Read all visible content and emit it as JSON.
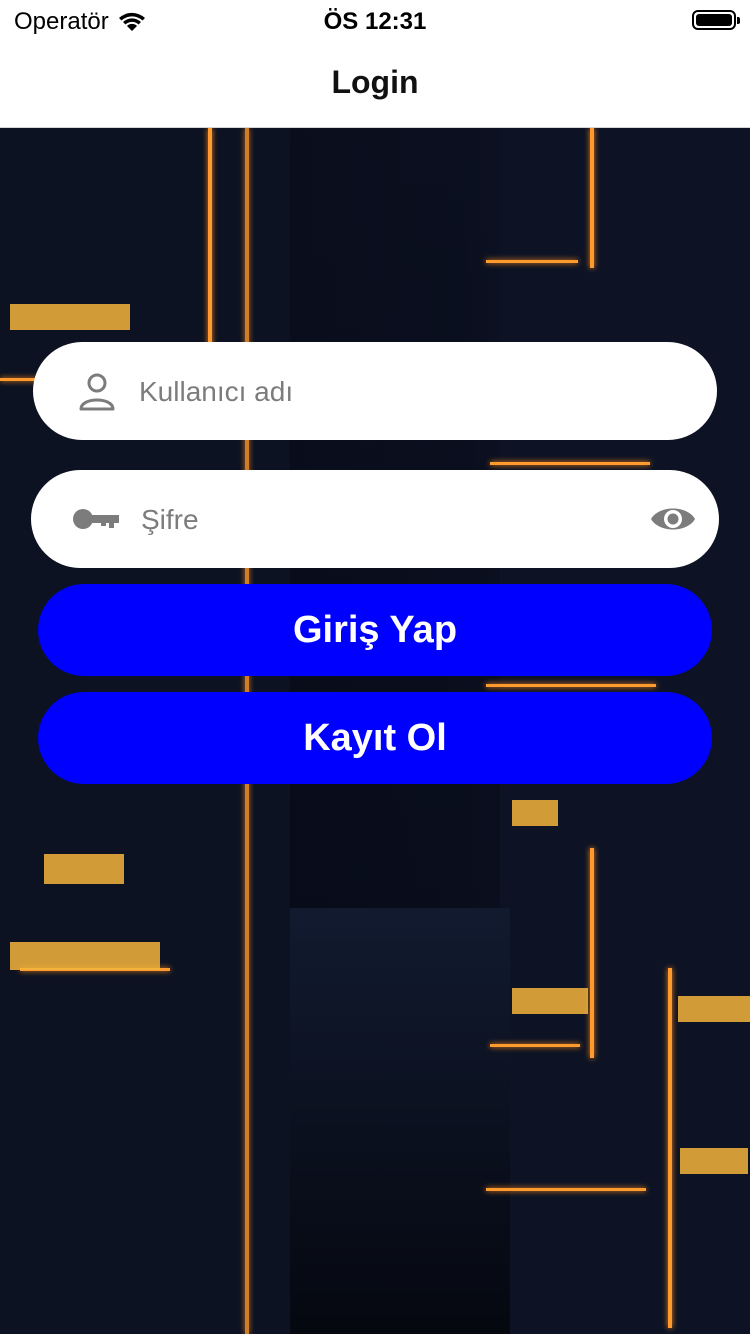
{
  "status": {
    "carrier": "Operatör",
    "time": "ÖS 12:31"
  },
  "nav": {
    "title": "Login"
  },
  "form": {
    "username_placeholder": "Kullanıcı adı",
    "password_placeholder": "Şifre",
    "login_label": "Giriş Yap",
    "register_label": "Kayıt Ol"
  },
  "icons": {
    "signal": "wifi-icon",
    "battery": "battery-icon",
    "user": "user-icon",
    "key": "key-icon",
    "eye": "eye-icon"
  },
  "colors": {
    "button": "#0000fe",
    "field_bg": "#ffffff",
    "placeholder": "#7c7c7c"
  }
}
